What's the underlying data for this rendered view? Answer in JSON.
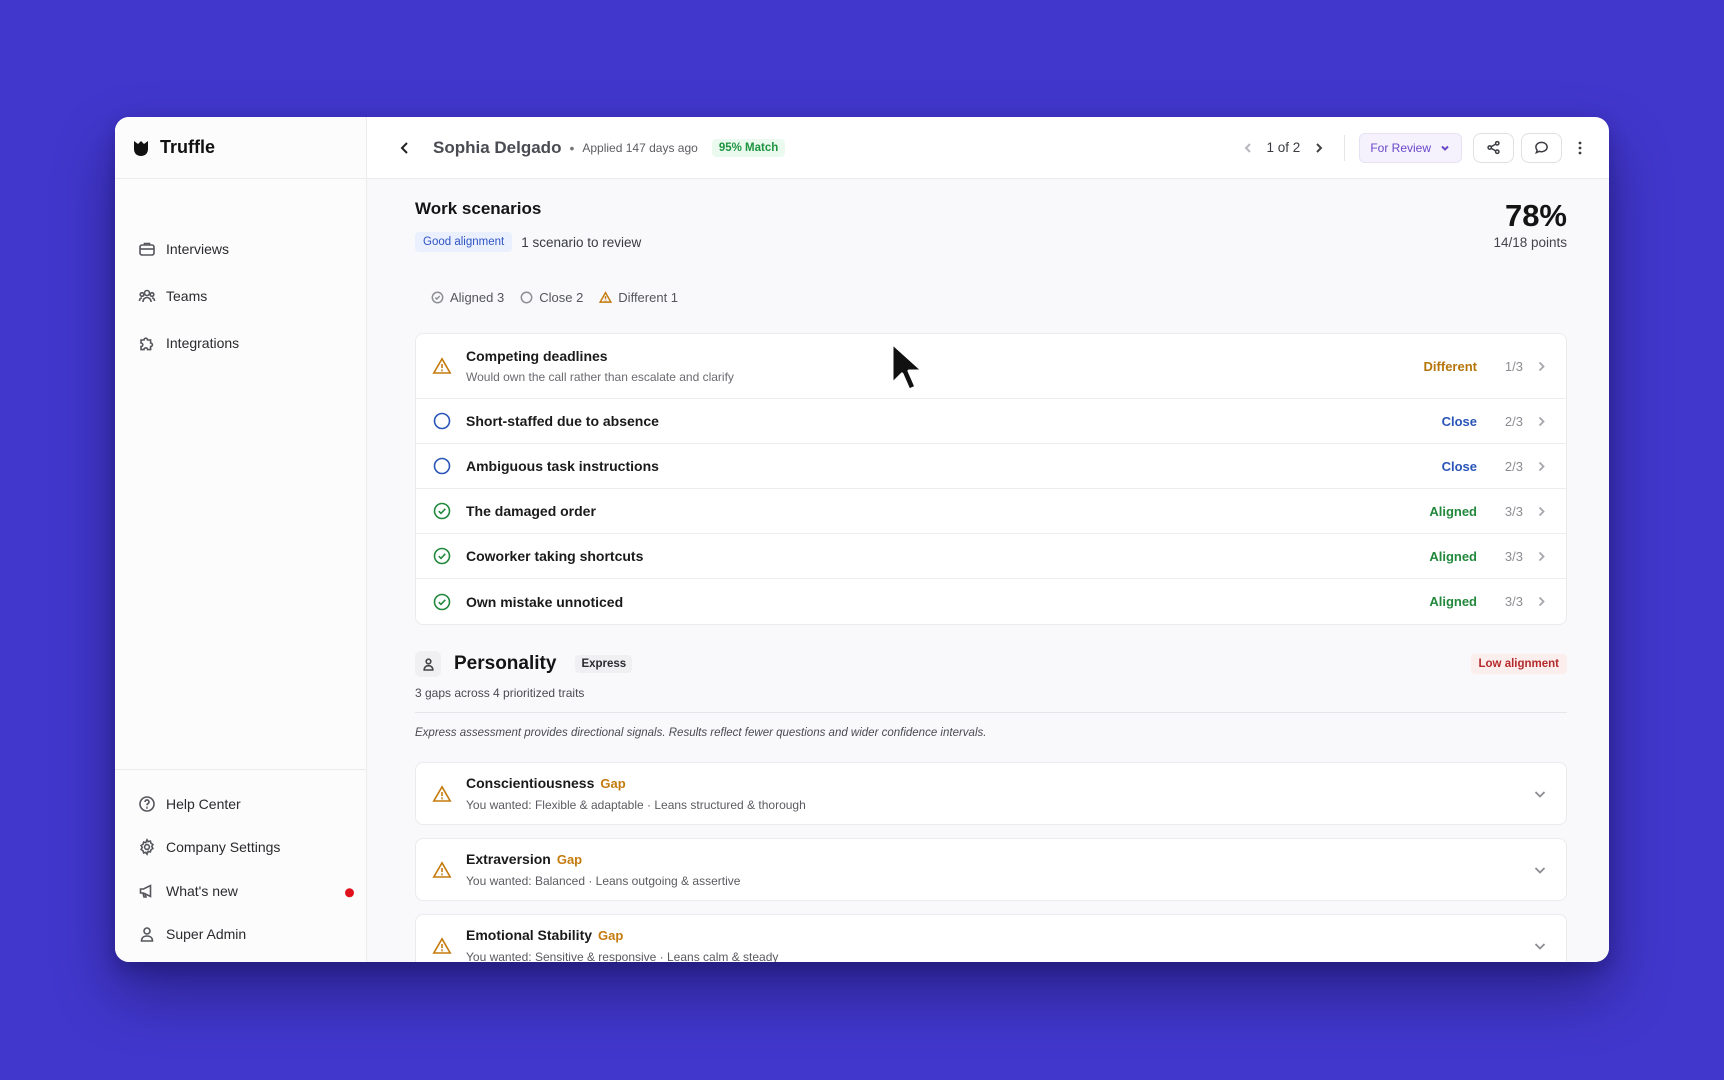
{
  "brand": {
    "name": "Truffle"
  },
  "nav": {
    "items": [
      {
        "label": "Interviews",
        "icon": "briefcase-icon"
      },
      {
        "label": "Teams",
        "icon": "users-icon"
      },
      {
        "label": "Integrations",
        "icon": "puzzle-icon"
      }
    ],
    "bottom": [
      {
        "label": "Help Center",
        "icon": "help-circle-icon"
      },
      {
        "label": "Company Settings",
        "icon": "gear-icon"
      },
      {
        "label": "What's new",
        "icon": "megaphone-icon",
        "has_notification": true
      },
      {
        "label": "Super Admin",
        "icon": "user-icon"
      }
    ]
  },
  "topbar": {
    "candidate_name": "Sophia Delgado",
    "separator": "•",
    "applied": "Applied 147 days ago",
    "match": "95% Match",
    "pager": "1 of 2",
    "status": "For Review"
  },
  "work_scenarios": {
    "title": "Work scenarios",
    "alignment_badge": "Good alignment",
    "review_text": "1 scenario to review",
    "score_percent": "78%",
    "score_points": "14/18 points",
    "legend": [
      {
        "label": "Aligned 3",
        "kind": "aligned"
      },
      {
        "label": "Close 2",
        "kind": "close"
      },
      {
        "label": "Different 1",
        "kind": "different"
      }
    ],
    "rows": [
      {
        "title": "Competing deadlines",
        "desc": "Would own the call rather than escalate and clarify",
        "status": "Different",
        "kind": "different",
        "score": "1/3"
      },
      {
        "title": "Short-staffed due to absence",
        "desc": "",
        "status": "Close",
        "kind": "close",
        "score": "2/3"
      },
      {
        "title": "Ambiguous task instructions",
        "desc": "",
        "status": "Close",
        "kind": "close",
        "score": "2/3"
      },
      {
        "title": "The damaged order",
        "desc": "",
        "status": "Aligned",
        "kind": "aligned",
        "score": "3/3"
      },
      {
        "title": "Coworker taking shortcuts",
        "desc": "",
        "status": "Aligned",
        "kind": "aligned",
        "score": "3/3"
      },
      {
        "title": "Own mistake unnoticed",
        "desc": "",
        "status": "Aligned",
        "kind": "aligned",
        "score": "3/3"
      }
    ]
  },
  "personality": {
    "title": "Personality",
    "mode_badge": "Express",
    "alignment_badge": "Low alignment",
    "subtitle": "3 gaps across 4 prioritized traits",
    "note": "Express assessment provides directional signals. Results reflect fewer questions and wider confidence intervals.",
    "traits": [
      {
        "title": "Conscientiousness",
        "tag": "Gap",
        "desc": "You wanted: Flexible & adaptable · Leans structured & thorough"
      },
      {
        "title": "Extraversion",
        "tag": "Gap",
        "desc": "You wanted: Balanced · Leans outgoing & assertive"
      },
      {
        "title": "Emotional Stability",
        "tag": "Gap",
        "desc": "You wanted: Sensitive & responsive · Leans calm & steady"
      }
    ]
  },
  "colors": {
    "background": "#4237cc",
    "aligned": "#22883c",
    "close": "#2a55b8",
    "different": "#b5750b",
    "gap": "#c47b0e"
  }
}
